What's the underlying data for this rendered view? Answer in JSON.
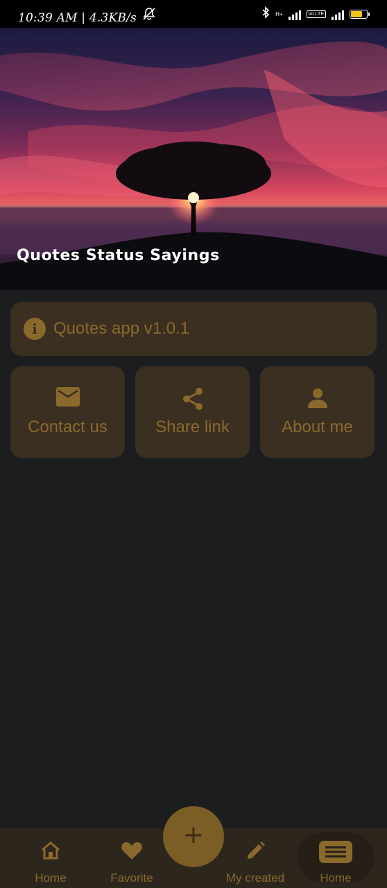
{
  "status_bar": {
    "time": "10:39 AM | 4.3KB/s",
    "network_tag": "H+",
    "volte_tag": "Vo LTE"
  },
  "hero": {
    "title": "Quotes Status Sayings"
  },
  "info_card": {
    "icon": "info-icon",
    "label": "Quotes app v1.0.1"
  },
  "actions": [
    {
      "icon": "mail-icon",
      "label": "Contact us"
    },
    {
      "icon": "share-icon",
      "label": "Share link"
    },
    {
      "icon": "person-icon",
      "label": "About me"
    }
  ],
  "bottom_nav": {
    "items": [
      {
        "icon": "home-icon",
        "label": "Home"
      },
      {
        "icon": "heart-icon",
        "label": "Favorite"
      },
      {
        "icon": "pencil-icon",
        "label": "My created"
      },
      {
        "icon": "menu-icon",
        "label": "Home"
      }
    ],
    "fab_icon": "plus-icon",
    "fab_label": "+"
  },
  "colors": {
    "background": "#1c1d1f",
    "card": "#3b2f22",
    "accent": "#8a6a2c",
    "fab": "#7b5e25",
    "nav": "#2d261d"
  }
}
